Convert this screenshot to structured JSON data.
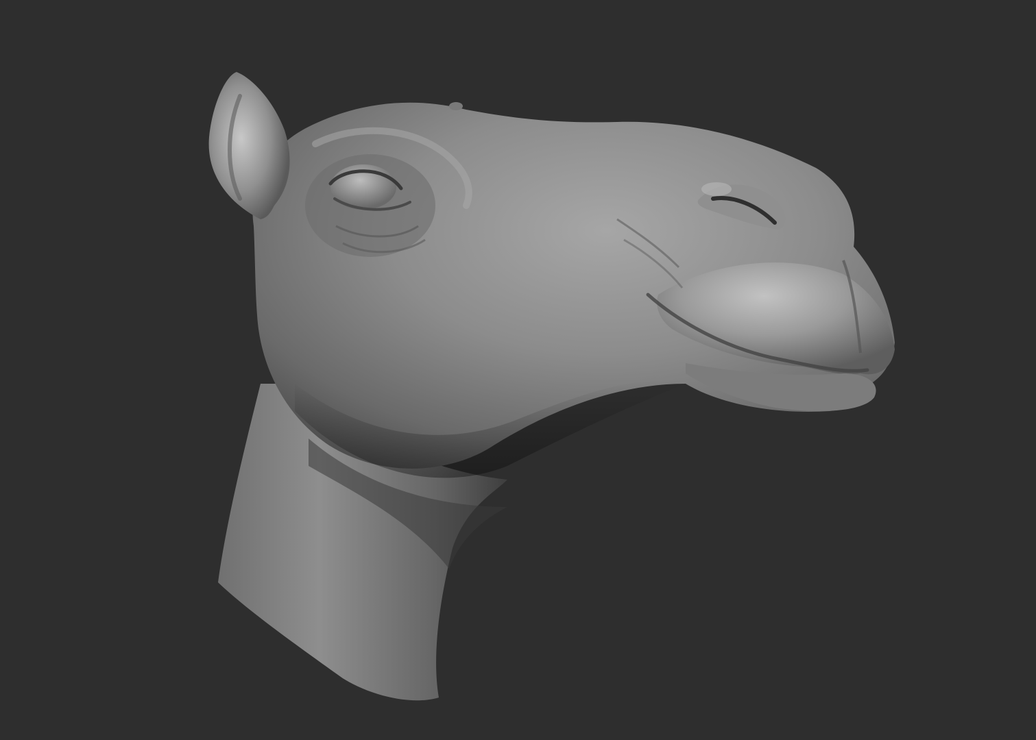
{
  "scene": {
    "subject": "camel-head-sculpt",
    "background_color": "#2e2e2e",
    "material_base_color": "#8a8a8a",
    "material_highlight_color": "#c4c4c4",
    "material_shadow_color": "#3c3c3c"
  }
}
